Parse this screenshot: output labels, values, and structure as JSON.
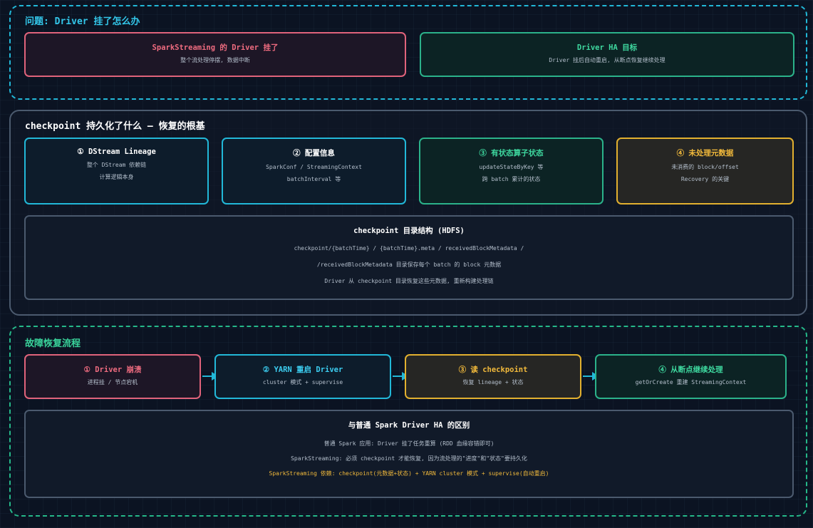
{
  "sections": {
    "problem": {
      "title": "问题: Driver 挂了怎么办",
      "left": {
        "title": "SparkStreaming 的 Driver 挂了",
        "lines": [
          "整个流处理停摆, 数据中断"
        ]
      },
      "right": {
        "title": "Driver HA 目标",
        "lines": [
          "Driver 挂后自动重启, 从断点恢复继续处理"
        ]
      }
    },
    "checkpoint": {
      "title": "checkpoint 持久化了什么 — 恢复的根基",
      "items": [
        {
          "title": "① DStream Lineage",
          "lines": [
            "整个 DStream 依赖链",
            "计算逻辑本身"
          ]
        },
        {
          "title": "② 配置信息",
          "lines": [
            "SparkConf / StreamingContext",
            "batchInterval 等"
          ]
        },
        {
          "title": "③ 有状态算子状态",
          "lines": [
            "updateStateByKey 等",
            "跨 batch 累计的状态"
          ]
        },
        {
          "title": "④ 未处理元数据",
          "lines": [
            "未消费的 block/offset",
            "Recovery 的关键"
          ]
        }
      ],
      "structure": {
        "title": "checkpoint 目录结构 (HDFS)",
        "lines": [
          "checkpoint/{batchTime} / {batchTime}.meta / receivedBlockMetadata /",
          "/receivedBlockMetadata 目录保存每个 batch 的 block 元数据",
          "Driver 从 checkpoint 目录恢复这些元数据, 重新构建处理链"
        ]
      }
    },
    "recovery": {
      "title": "故障恢复流程",
      "steps": [
        {
          "title": "① Driver 崩溃",
          "line": "进程挂 / 节点宕机"
        },
        {
          "title": "② YARN 重启 Driver",
          "line": "cluster 模式 + supervise"
        },
        {
          "title": "③ 读 checkpoint",
          "line": "恢复 lineage + 状态"
        },
        {
          "title": "④ 从断点继续处理",
          "line": "getOrCreate 重建 StreamingContext"
        }
      ],
      "compare": {
        "title": "与普通 Spark Driver HA 的区别",
        "lines": [
          "普通 Spark 应用: Driver 挂了任务重算 (RDD 血缘容错即可)",
          "SparkStreaming: 必须 checkpoint 才能恢复, 因为流处理的\"进度\"和\"状态\"要持久化",
          "SparkStreaming 依赖: checkpoint(元数据+状态) + YARN cluster 模式 + supervise(自动重启)"
        ]
      }
    }
  },
  "colors": {
    "cyan": "#22b8d8",
    "green": "#2bb28a",
    "red": "#e0637b",
    "orange": "#e2b02f",
    "gray": "#4b5a6e"
  }
}
